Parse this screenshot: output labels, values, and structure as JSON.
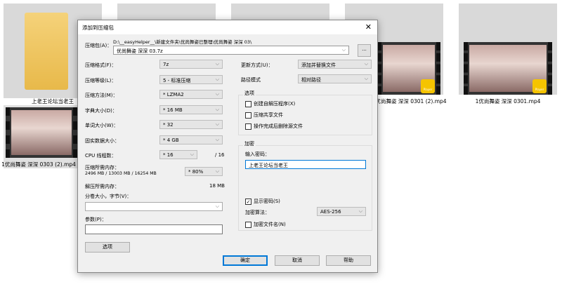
{
  "desktop": {
    "files": [
      {
        "name": "上老王论坛当老王",
        "type": "folder"
      },
      {
        "name": "1优尚舞姿 深深 0303 (2).mp4",
        "type": "video"
      },
      {
        "name": "优尚舞姿 深深 0301 (2).mp4",
        "type": "video"
      },
      {
        "name": "1优尚舞姿 深深 0301.mp4",
        "type": "video"
      }
    ],
    "player_badge": "Player"
  },
  "dialog": {
    "title": "添加到压缩包",
    "archive_label": "压缩包(A)：",
    "archive_path": "D:\\__easyHelper__\\新建文件夹\\优尚舞姿已整理\\优尚舞姿 深深 03\\",
    "archive_name": "优尚舞姿 深深 03.7z",
    "browse": "...",
    "left": [
      {
        "label": "压缩格式(F)：",
        "value": "7z"
      },
      {
        "label": "压缩等级(L)：",
        "value": "5 - 标准压缩"
      },
      {
        "label": "压缩方法(M)：",
        "value": "* LZMA2"
      },
      {
        "label": "字典大小(D)：",
        "value": "* 16 MB"
      },
      {
        "label": "单词大小(W)：",
        "value": "* 32"
      },
      {
        "label": "固实数据大小：",
        "value": "* 4 GB"
      }
    ],
    "cpu_label": "CPU 线程数：",
    "cpu_value": "* 16",
    "cpu_max": "/ 16",
    "mem_label": "压缩所需内存：",
    "mem_detail": "2496 MB / 13003 MB / 16254 MB",
    "mem_value": "* 80%",
    "decomp_label": "解压所需内存：",
    "decomp_value": "18 MB",
    "split_label": "分卷大小，字节(V)：",
    "split_value": "",
    "params_label": "参数(P)：",
    "params_value": "",
    "options_button": "选项",
    "update_label": "更新方式(U)：",
    "update_value": "添加并替换文件",
    "path_label": "路径模式",
    "path_value": "相对路径",
    "options_group": "选项",
    "options": [
      {
        "label": "创建自解压程序(X)",
        "checked": false
      },
      {
        "label": "压缩共享文件",
        "checked": false
      },
      {
        "label": "操作完成后删除源文件",
        "checked": false
      }
    ],
    "encrypt_group": "加密",
    "password_label": "输入密码：",
    "password_value": "上老王论坛当老王",
    "show_password": {
      "label": "显示密码(S)",
      "checked": true
    },
    "algo_label": "加密算法：",
    "algo_value": "AES-256",
    "encrypt_names": {
      "label": "加密文件名(N)",
      "checked": false
    },
    "ok": "确定",
    "cancel": "取消",
    "help": "帮助"
  }
}
